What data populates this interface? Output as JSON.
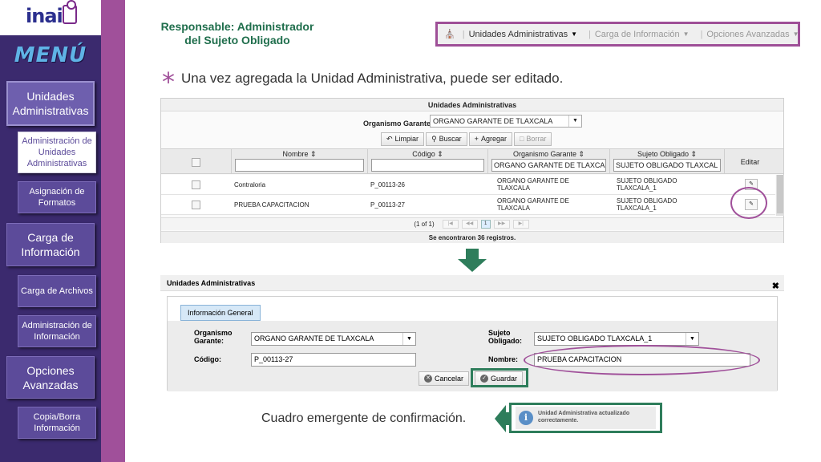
{
  "sidebar": {
    "logo_text": "inai",
    "menu_title": "MENÚ",
    "items": [
      {
        "label": "Unidades Administrativas"
      },
      {
        "label": "Administración de Unidades Administrativas"
      },
      {
        "label": "Asignación de Formatos"
      },
      {
        "label": "Carga de Información"
      },
      {
        "label": "Carga de Archivos"
      },
      {
        "label": "Administración de Información"
      },
      {
        "label": "Opciones Avanzadas"
      },
      {
        "label": "Copia/Borra Información"
      }
    ]
  },
  "header": {
    "responsable_line1": "Responsable: Administrador",
    "responsable_line2": "del Sujeto Obligado"
  },
  "navbar": {
    "items": [
      {
        "label": "Unidades Administrativas"
      },
      {
        "label": "Carga de Información"
      },
      {
        "label": "Opciones Avanzadas"
      }
    ]
  },
  "note": "Una vez agregada la Unidad Administrativa, puede ser editado.",
  "grid": {
    "title": "Unidades Administrativas",
    "organismo_label": "Organismo Garante:",
    "organismo_value": "ORGANO GARANTE DE TLAXCALA",
    "toolbar": {
      "limpiar": "Limpiar",
      "buscar": "Buscar",
      "agregar": "Agregar",
      "borrar": "Borrar"
    },
    "columns": {
      "nombre": "Nombre",
      "codigo": "Código",
      "organismo": "Organismo Garante",
      "sujeto": "Sujeto Obligado",
      "editar": "Editar"
    },
    "filters": {
      "organismo": "ORGANO GARANTE DE TLAXCA",
      "sujeto": "SUJETO OBLIGADO TLAXCAL"
    },
    "rows": [
      {
        "nombre": "Contraloria",
        "codigo": "P_00113-26",
        "organismo": "ORGANO GARANTE DE TLAXCALA",
        "sujeto": "SUJETO OBLIGADO TLAXCALA_1"
      },
      {
        "nombre": "PRUEBA CAPACITACION",
        "codigo": "P_00113-27",
        "organismo": "ORGANO GARANTE DE TLAXCALA",
        "sujeto": "SUJETO OBLIGADO TLAXCALA_1"
      }
    ],
    "pager_text": "(1 of 1)",
    "current_page": "1",
    "found_text": "Se encontraron 36 registros."
  },
  "dialog": {
    "title": "Unidades Administrativas",
    "tab": "Información General",
    "organismo_label_1": "Organismo",
    "organismo_label_2": "Garante:",
    "organismo_value": "ORGANO GARANTE DE TLAXCALA",
    "sujeto_label_1": "Sujeto",
    "sujeto_label_2": "Obligado:",
    "sujeto_value": "SUJETO OBLIGADO TLAXCALA_1",
    "codigo_label": "Código:",
    "codigo_value": "P_00113-27",
    "nombre_label": "Nombre:",
    "nombre_value": "PRUEBA CAPACITACION",
    "cancel": "Cancelar",
    "save": "Guardar"
  },
  "confirmation": {
    "caption": "Cuadro emergente de confirmación.",
    "message": "Unidad Administrativa actualizado correctamente."
  },
  "colors": {
    "sidebar": "#3b2a6e",
    "accent_purple": "#a0509a",
    "accent_green": "#2e7d5b"
  }
}
